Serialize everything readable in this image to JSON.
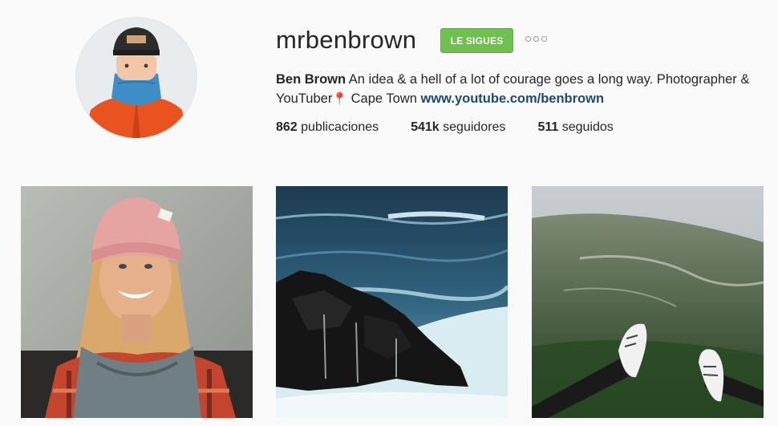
{
  "profile": {
    "username": "mrbenbrown",
    "follow_button_label": "LE SIGUES",
    "more_icon": "ellipsis-icon",
    "bio": {
      "full_name": "Ben Brown",
      "text_before_pin": "An idea & a hell of a lot of courage goes a long way. Photographer & YouTuber",
      "pin_glyph": "📍",
      "text_after_pin": "Cape Town",
      "link": "www.youtube.com/benbrown"
    },
    "stats": [
      {
        "value": "862",
        "label": "publicaciones"
      },
      {
        "value": "541k",
        "label": "seguidores"
      },
      {
        "value": "511",
        "label": "seguidos"
      }
    ]
  },
  "colors": {
    "follow_button": "#70c050",
    "link": "#1b4a7a",
    "background": "#fafafa"
  }
}
